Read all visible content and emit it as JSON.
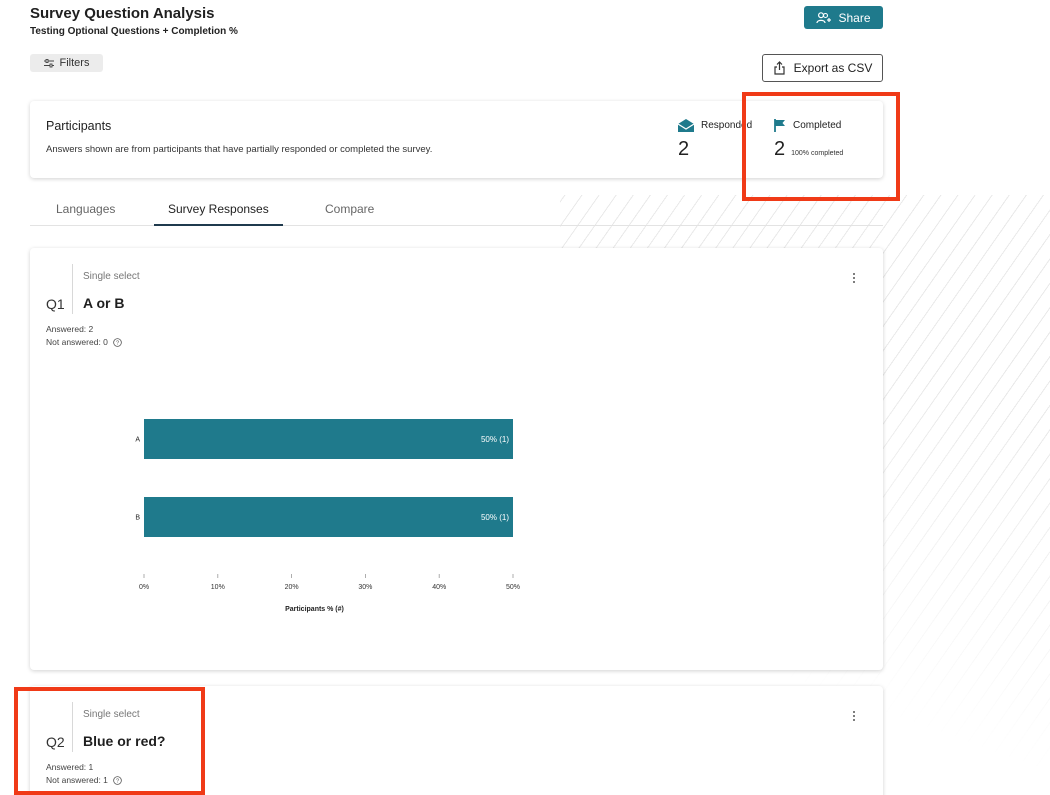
{
  "header": {
    "title": "Survey Question Analysis",
    "subtitle": "Testing Optional Questions + Completion %",
    "share_label": "Share",
    "filters_label": "Filters",
    "export_label": "Export as CSV"
  },
  "participants": {
    "title": "Participants",
    "description": "Answers shown are from participants that have partially responded or completed the survey.",
    "responded_label": "Responded",
    "responded_value": "2",
    "completed_label": "Completed",
    "completed_value": "2",
    "completed_sub": "100% completed"
  },
  "tabs": [
    {
      "label": "Languages",
      "active": false
    },
    {
      "label": "Survey Responses",
      "active": true
    },
    {
      "label": "Compare",
      "active": false
    }
  ],
  "questions": [
    {
      "type": "Single select",
      "number": "Q1",
      "title": "A or B",
      "answered": "Answered: 2",
      "not_answered": "Not answered: 0"
    },
    {
      "type": "Single select",
      "number": "Q2",
      "title": "Blue or red?",
      "answered": "Answered: 1",
      "not_answered": "Not answered: 1"
    }
  ],
  "colors": {
    "accent": "#1f7a8c",
    "highlight": "#f03a17"
  },
  "chart_data": {
    "type": "bar",
    "orientation": "horizontal",
    "categories": [
      "A",
      "B"
    ],
    "values": [
      50,
      50
    ],
    "data_labels": [
      "50% (1)",
      "50% (1)"
    ],
    "xticks": [
      "0%",
      "10%",
      "20%",
      "30%",
      "40%",
      "50%"
    ],
    "xlim": [
      0,
      50
    ],
    "xlabel": "Participants % (#)",
    "ylabel": "",
    "title": "",
    "grid": false
  }
}
